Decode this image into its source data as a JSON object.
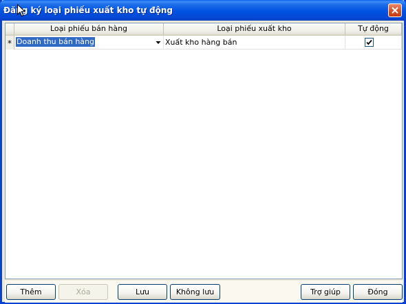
{
  "window": {
    "title": "Đăng ký loại phiếu xuất kho tự động"
  },
  "grid": {
    "headers": {
      "sales_type": "Loại phiếu bán hàng",
      "export_type": "Loại phiếu xuất kho",
      "auto": "Tự động"
    },
    "rows": [
      {
        "marker": "*",
        "sales_type": "Doanh thu bán hàng",
        "export_type": "Xuất kho hàng bán",
        "auto_checked": true
      }
    ]
  },
  "buttons": {
    "add": "Thêm",
    "delete": "Xóa",
    "save": "Lưu",
    "dont_save": "Không lưu",
    "help": "Trợ giúp",
    "close": "Đóng"
  },
  "colors": {
    "titlebar": "#0052e0",
    "selection": "#316ac5",
    "close_button": "#d8542c"
  }
}
